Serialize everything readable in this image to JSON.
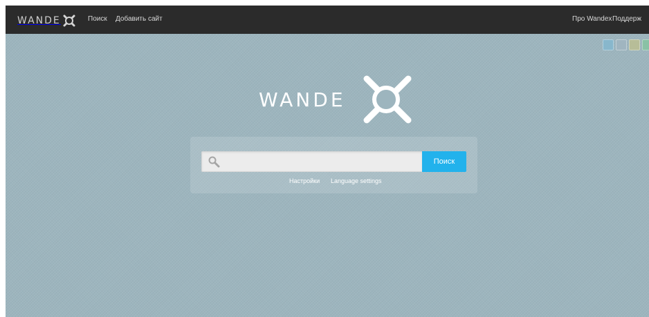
{
  "brand": {
    "name": "WANDE"
  },
  "nav": {
    "left": [
      {
        "label": "Поиск"
      },
      {
        "label": "Добавить сайт"
      }
    ],
    "right": [
      {
        "label": "Про Wandex"
      },
      {
        "label": "Поддерж"
      }
    ]
  },
  "themes": {
    "colors": [
      "#88b7cc",
      "#a0b5c0",
      "#b7bd98",
      "#89c1a5"
    ]
  },
  "hero": {
    "logo_text": "WANDE",
    "mark_icon": "wandex-x-logo-icon"
  },
  "search": {
    "placeholder": "",
    "value": "",
    "button_label": "Поиск",
    "icon": "search-icon",
    "button_color": "#22b2ec"
  },
  "links": {
    "settings": "Настройки",
    "language": "Language settings"
  },
  "colors": {
    "topbar": "#2b2b2b",
    "background": "#9db5be",
    "accent": "#22b2ec"
  }
}
